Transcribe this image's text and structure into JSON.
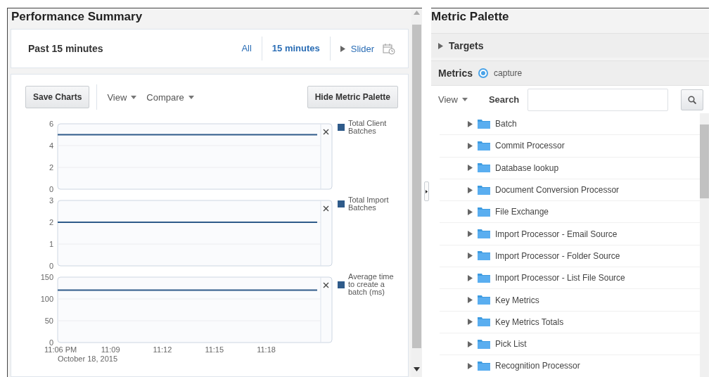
{
  "left_panel": {
    "title": "Performance Summary",
    "range": {
      "label": "Past 15 minutes",
      "options": [
        {
          "label": "All",
          "selected": false
        },
        {
          "label": "15 minutes",
          "selected": true
        }
      ],
      "slider": {
        "label": "Slider",
        "expanded": false
      }
    },
    "toolbar": {
      "save_button": "Save Charts",
      "menus": [
        "View",
        "Compare"
      ],
      "hide_button": "Hide Metric Palette"
    },
    "charts": [
      {
        "chart_data": {
          "type": "line",
          "categories": [
            null,
            null,
            null,
            null,
            null,
            null,
            null,
            null,
            null,
            null,
            null,
            null,
            null,
            null,
            null,
            null
          ],
          "ylim": [
            0,
            6
          ],
          "yticks": [
            0,
            2,
            4,
            6
          ],
          "series": [
            {
              "name": "Total Client Batches",
              "color": "#2f5b8a",
              "values": [
                5,
                5,
                5,
                5,
                5,
                5,
                5,
                5,
                5,
                5,
                5,
                5,
                5,
                5,
                5,
                5
              ]
            }
          ]
        }
      },
      {
        "chart_data": {
          "type": "line",
          "categories": [
            null,
            null,
            null,
            null,
            null,
            null,
            null,
            null,
            null,
            null,
            null,
            null,
            null,
            null,
            null,
            null
          ],
          "ylim": [
            0,
            3
          ],
          "yticks": [
            0,
            1,
            2,
            3
          ],
          "series": [
            {
              "name": "Total Import Batches",
              "color": "#2f5b8a",
              "values": [
                2,
                2,
                2,
                2,
                2,
                2,
                2,
                2,
                2,
                2,
                2,
                2,
                2,
                2,
                2,
                2
              ]
            }
          ]
        }
      },
      {
        "chart_data": {
          "type": "line",
          "categories": [
            "11:06 PM",
            null,
            null,
            "11:09",
            null,
            null,
            "11:12",
            null,
            null,
            "11:15",
            null,
            null,
            "11:18",
            null,
            null,
            null
          ],
          "ylim": [
            0,
            150
          ],
          "yticks": [
            0,
            50,
            100,
            150
          ],
          "xlabel": "October 18, 2015",
          "series": [
            {
              "name": "Average time to create a batch (ms)",
              "color": "#2f5b8a",
              "values": [
                120,
                120,
                120,
                120,
                120,
                120,
                120,
                120,
                120,
                120,
                120,
                120,
                120,
                120,
                120,
                120
              ]
            }
          ]
        }
      }
    ]
  },
  "right_panel": {
    "title": "Metric Palette",
    "targets": {
      "label": "Targets",
      "expanded": false
    },
    "metrics": {
      "label": "Metrics",
      "options": [
        {
          "label": "capture",
          "selected": true
        }
      ]
    },
    "search_bar": {
      "view": "View",
      "label": "Search"
    },
    "tree": [
      {
        "label": "Batch",
        "expanded": false
      },
      {
        "label": "Commit Processor",
        "expanded": false
      },
      {
        "label": "Database lookup",
        "expanded": false
      },
      {
        "label": "Document Conversion Processor",
        "expanded": false
      },
      {
        "label": "File Exchange",
        "expanded": false
      },
      {
        "label": "Import Processor - Email Source",
        "expanded": false
      },
      {
        "label": "Import Processor - Folder Source",
        "expanded": false
      },
      {
        "label": "Import Processor - List File Source",
        "expanded": false
      },
      {
        "label": "Key Metrics",
        "expanded": false
      },
      {
        "label": "Key Metrics Totals",
        "expanded": false
      },
      {
        "label": "Pick List",
        "expanded": false
      },
      {
        "label": "Recognition Processor",
        "expanded": false
      }
    ]
  }
}
